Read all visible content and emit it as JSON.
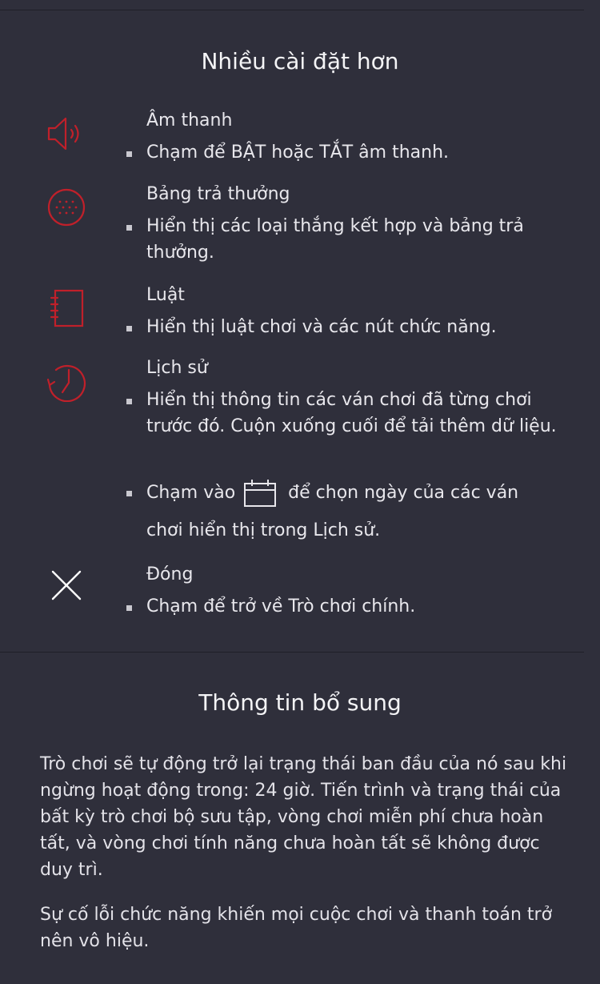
{
  "settings": {
    "title": "Nhiều cài đặt hơn",
    "items": [
      {
        "icon": "speaker-icon",
        "label": "Âm thanh",
        "desc": "Chạm để BẬT hoặc TẮT âm thanh."
      },
      {
        "icon": "paytable-icon",
        "label": "Bảng trả thưởng",
        "desc": "Hiển thị các loại thắng kết hợp và bảng trả thưởng."
      },
      {
        "icon": "notebook-icon",
        "label": "Luật",
        "desc": "Hiển thị luật chơi và các nút chức năng."
      },
      {
        "icon": "history-clock-icon",
        "label": "Lịch sử",
        "desc": "Hiển thị thông tin các ván chơi đã từng chơi trước đó. Cuộn xuống cuối để tải thêm dữ liệu."
      },
      {
        "icon": "close-icon",
        "label": "Đóng",
        "desc": "Chạm để trở về Trò chơi chính."
      }
    ],
    "history_date_tip_before": "Chạm vào",
    "history_date_tip_after": "để chọn ngày của các ván",
    "history_date_tip_line2": "chơi hiển thị trong Lịch sử."
  },
  "additional": {
    "title": "Thông tin bổ sung",
    "paragraphs": [
      "Trò chơi sẽ tự động trở lại trạng thái ban đầu của nó sau khi ngừng hoạt động trong: 24 giờ. Tiến trình và trạng thái của bất kỳ trò chơi bộ sưu tập, vòng chơi miễn phí chưa hoàn tất, và vòng chơi tính năng chưa hoàn tất sẽ không được duy trì.",
      "Sự cố lỗi chức năng khiến mọi cuộc chơi và thanh toán trở nên vô hiệu."
    ]
  },
  "colors": {
    "background": "#2f2f3b",
    "accent": "#c0202a",
    "text": "#e8e7ec"
  }
}
